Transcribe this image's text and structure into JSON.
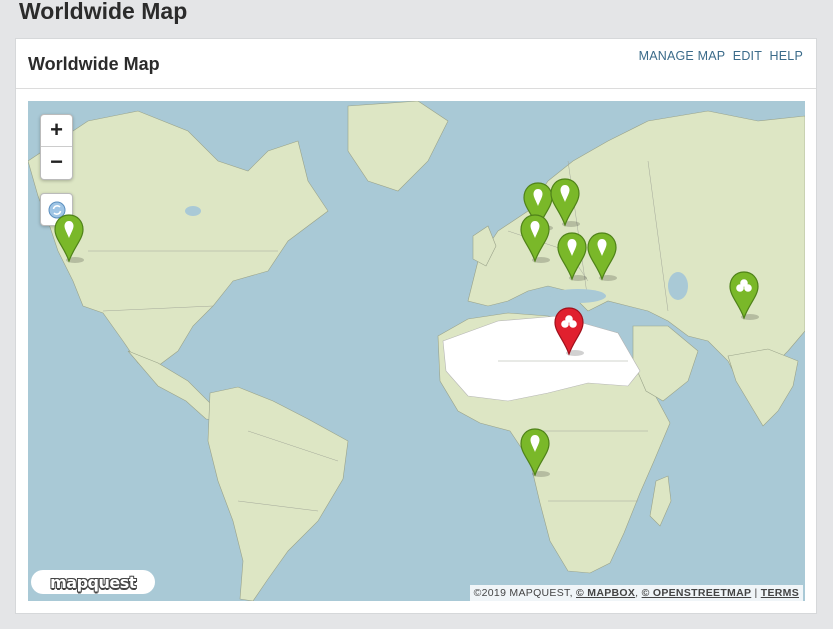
{
  "page": {
    "title": "Worldwide Map"
  },
  "panel": {
    "title": "Worldwide Map",
    "actions": {
      "manage_map": "MANAGE MAP",
      "edit": "EDIT",
      "help": "HELP"
    }
  },
  "map": {
    "zoom_in_label": "+",
    "zoom_out_label": "−",
    "reset_icon": "refresh-icon",
    "logo_text": "mapquest",
    "attribution": {
      "copyright": "©2019 MAPQUEST, ",
      "mapbox": "© MAPBOX",
      "sep1": ", ",
      "osm": "© OPENSTREETMAP",
      "sep2": " | ",
      "terms": "TERMS"
    },
    "colors": {
      "green_marker": "#7ab829",
      "red_marker": "#e0202e",
      "water": "#a9c9d6",
      "land": "#dde6c4"
    },
    "markers": [
      {
        "location": "California",
        "color": "green",
        "icon": "pin-dot-icon",
        "lat": 35,
        "lon": -118
      },
      {
        "location": "Balkans",
        "color": "green",
        "icon": "pin-dot-icon",
        "lat": 44,
        "lon": 21
      },
      {
        "location": "Black Sea region",
        "color": "green",
        "icon": "pin-dot-icon",
        "lat": 45,
        "lon": 29
      },
      {
        "location": "Eastern Mediterranean",
        "color": "green",
        "icon": "pin-dot-icon",
        "lat": 35,
        "lon": 20
      },
      {
        "location": "Middle East",
        "color": "green",
        "icon": "pin-dot-icon",
        "lat": 30,
        "lon": 31
      },
      {
        "location": "Persian Gulf",
        "color": "green",
        "icon": "pin-dot-icon",
        "lat": 30,
        "lon": 40
      },
      {
        "location": "India",
        "color": "green",
        "icon": "cluster-icon",
        "lat": 19,
        "lon": 82
      },
      {
        "location": "Horn of Africa",
        "color": "red",
        "icon": "cluster-icon",
        "lat": 9,
        "lon": 30
      },
      {
        "location": "South Africa",
        "color": "green",
        "icon": "pin-dot-icon",
        "lat": -25,
        "lon": 20
      }
    ]
  }
}
